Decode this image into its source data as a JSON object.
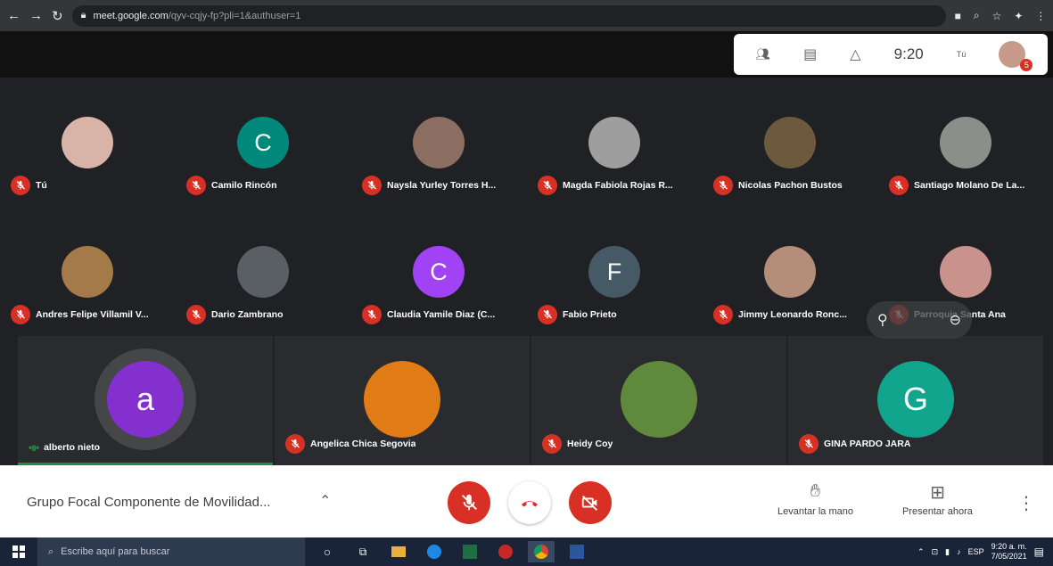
{
  "browser": {
    "url_domain": "meet.google.com",
    "url_path": "/qyv-cqjy-fp?pli=1&authuser=1"
  },
  "toolbar": {
    "time": "9:20",
    "self_label": "Tú",
    "notification_count": "5"
  },
  "participants": [
    {
      "name": "Tú",
      "initial": "",
      "color": "#d8b4a8",
      "speaking": false
    },
    {
      "name": "Camilo Rincón",
      "initial": "C",
      "color": "#00897b",
      "speaking": false
    },
    {
      "name": "Naysla Yurley Torres H...",
      "initial": "",
      "color": "#8d6e63",
      "speaking": false
    },
    {
      "name": "Magda Fabiola Rojas R...",
      "initial": "",
      "color": "#9e9e9e",
      "speaking": false
    },
    {
      "name": "Nicolas Pachon Bustos",
      "initial": "",
      "color": "#6d5a3e",
      "speaking": false
    },
    {
      "name": "Santiago Molano De La...",
      "initial": "",
      "color": "#8a8f8a",
      "speaking": false
    },
    {
      "name": "Andres Felipe Villamil V...",
      "initial": "",
      "color": "#a37a48",
      "speaking": false
    },
    {
      "name": "Dario Zambrano",
      "initial": "",
      "color": "#5a5f63",
      "speaking": false
    },
    {
      "name": "Claudia Yamile Diaz (C...",
      "initial": "C",
      "color": "#a142f4",
      "speaking": false
    },
    {
      "name": "Fabio Prieto",
      "initial": "F",
      "color": "#455a64",
      "speaking": false
    },
    {
      "name": "Jimmy Leonardo Ronc...",
      "initial": "",
      "color": "#b58e7a",
      "speaking": false
    },
    {
      "name": "Parroquia Santa Ana",
      "initial": "",
      "color": "#c9928c",
      "speaking": false
    },
    {
      "name": "alberto nieto",
      "initial": "a",
      "color": "#8430ce",
      "speaking": true
    },
    {
      "name": "Angelica Chica Segovia",
      "initial": "",
      "color": "#e07b16",
      "speaking": false
    },
    {
      "name": "Heidy Coy",
      "initial": "",
      "color": "#5f8a3c",
      "speaking": false
    },
    {
      "name": "GINA PARDO JARA",
      "initial": "G",
      "color": "#12a58e",
      "speaking": false
    }
  ],
  "meeting": {
    "title": "Grupo Focal Componente de Movilidad..."
  },
  "actions": {
    "raise_hand": "Levantar la mano",
    "present": "Presentar ahora"
  },
  "taskbar": {
    "search_placeholder": "Escribe aquí para buscar",
    "time": "9:20 a. m.",
    "date": "7/05/2021",
    "lang": "ESP"
  }
}
